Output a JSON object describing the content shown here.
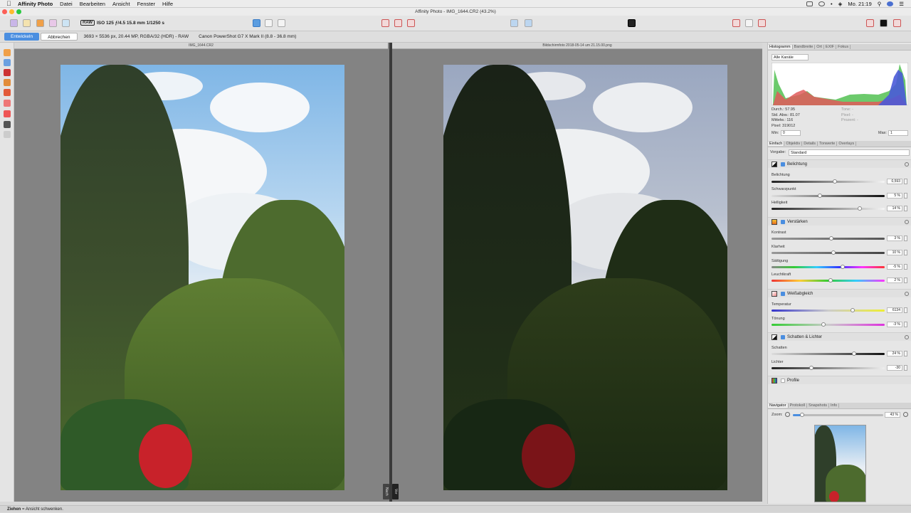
{
  "menubar": {
    "app_name": "Affinity Photo",
    "items": [
      "Datei",
      "Bearbeiten",
      "Ansicht",
      "Fenster",
      "Hilfe"
    ],
    "clock": "Mo. 21:19"
  },
  "window": {
    "title": "Affinity Photo - IMG_1644.CR2 (43.2%)"
  },
  "toolbar": {
    "raw_badge": "RAW",
    "raw_info": "ISO 125 ƒ/4.5 15.8 mm 1/1250 s"
  },
  "context": {
    "develop_label": "Entwickeln",
    "cancel_label": "Abbrechen",
    "doc_info": "3693 × 5536 px, 20.44 MP, RGBA/32 (HDR) - RAW",
    "camera_info": "Canon PowerShot G7 X Mark II (8.8 - 36.8 mm)"
  },
  "canvas": {
    "left_title": "IMG_1644.CR2",
    "right_title": "Bildschirmfoto 2018-05-14 um 21.15.00.png",
    "after_tab": "Nach",
    "before_tab": "Vor"
  },
  "histogram": {
    "tabs": [
      "Histogramm",
      "Bandbreite",
      "Ort",
      "EXIF",
      "Fokus"
    ],
    "channel": "Alle Kanäle",
    "stats_left": [
      "Durch.: 57.95",
      "Std. Abw.: 81.07",
      "Mittelw.: 116",
      "Pixel: 319012"
    ],
    "stats_right": [
      "Tone: -",
      "Pixel: -",
      "Prozent: -"
    ],
    "min_label": "Min:",
    "min_value": "0",
    "max_label": "Max:",
    "max_value": "1"
  },
  "develop": {
    "tabs": [
      "Einfach",
      "Objektiv",
      "Details",
      "Tonwerte",
      "Overlays"
    ],
    "preset_label": "Vorgabe:",
    "preset_value": "Standard",
    "sections": [
      {
        "title": "Belichtung",
        "sliders": [
          {
            "label": "Belichtung",
            "value": "0,593",
            "pos": 0.56
          },
          {
            "label": "Schwarzpunkt",
            "value": "5 %",
            "pos": 0.43
          },
          {
            "label": "Helligkeit",
            "value": "14 %",
            "pos": 0.78
          }
        ]
      },
      {
        "title": "Verstärken",
        "sliders": [
          {
            "label": "Kontrast",
            "value": "3 %",
            "pos": 0.53
          },
          {
            "label": "Klarheit",
            "value": "10 %",
            "pos": 0.55
          },
          {
            "label": "Sättigung",
            "value": "-5 %",
            "pos": 0.63
          },
          {
            "label": "Leuchtkraft",
            "value": "2 %",
            "pos": 0.52
          }
        ]
      },
      {
        "title": "Weißabgleich",
        "sliders": [
          {
            "label": "Temperatur",
            "value": "6134",
            "pos": 0.72
          },
          {
            "label": "Tönung",
            "value": "-3 %",
            "pos": 0.46
          }
        ]
      },
      {
        "title": "Schatten & Lichter",
        "sliders": [
          {
            "label": "Schatten",
            "value": "24 %",
            "pos": 0.73
          },
          {
            "label": "Lichter",
            "value": "-30",
            "pos": 0.35
          }
        ]
      }
    ],
    "profile_label": "Profile"
  },
  "navigator": {
    "tabs": [
      "Navigator",
      "Protokoll",
      "Snapshots",
      "Info"
    ],
    "zoom_label": "Zoom:",
    "zoom_value": "43 %",
    "zoom_fraction": 0.1
  },
  "status": {
    "bold": "Ziehen",
    "text": " = Ansicht schwenken."
  }
}
